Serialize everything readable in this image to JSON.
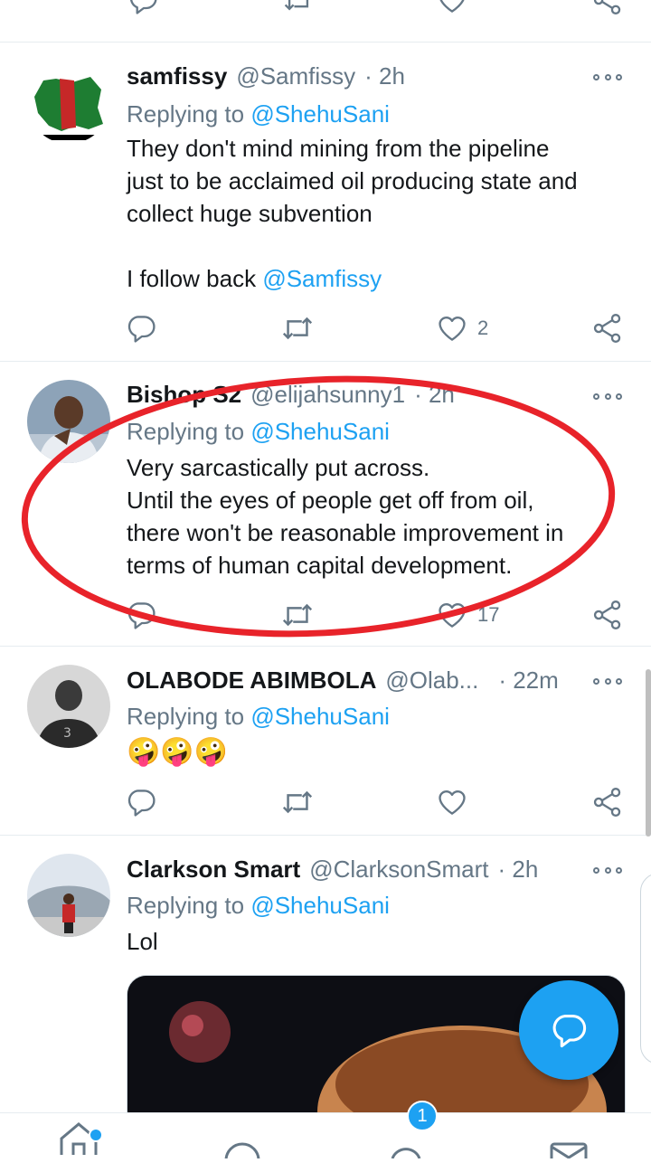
{
  "tweets": [
    {
      "name": "samfissy",
      "handle": "@Samfissy",
      "time": "· 2h",
      "replying_prefix": "Replying to",
      "replying_to": "@ShehuSani",
      "lines": [
        "They don't mind mining from the pipeline",
        "just to be acclaimed oil producing state and",
        "collect huge subvention"
      ],
      "follow_text": "I follow back",
      "follow_mention": "@Samfissy",
      "like_count": "2"
    },
    {
      "name": "Bishop S2",
      "handle": "@elijahsunny1",
      "time": "· 2h",
      "replying_prefix": "Replying to",
      "replying_to": "@ShehuSani",
      "lines": [
        "Very sarcastically put across.",
        "Until the eyes of people get off from oil,",
        "there won't be reasonable improvement in",
        "terms of human capital development."
      ],
      "like_count": "17"
    },
    {
      "name": "OLABODE ABIMBOLA",
      "handle": "@Olab...",
      "time": "· 22m",
      "replying_prefix": "Replying to",
      "replying_to": "@ShehuSani",
      "emoji": "🤪🤪🤪"
    },
    {
      "name": "Clarkson Smart",
      "handle": "@ClarksonSmart",
      "time": "· 2h",
      "replying_prefix": "Replying to",
      "replying_to": "@ShehuSani",
      "text": "Lol"
    }
  ],
  "nav": {
    "notifications_badge": "1"
  },
  "colors": {
    "accent": "#1da1f2",
    "secondary_text": "#657786",
    "annotation": "#e8232a"
  }
}
